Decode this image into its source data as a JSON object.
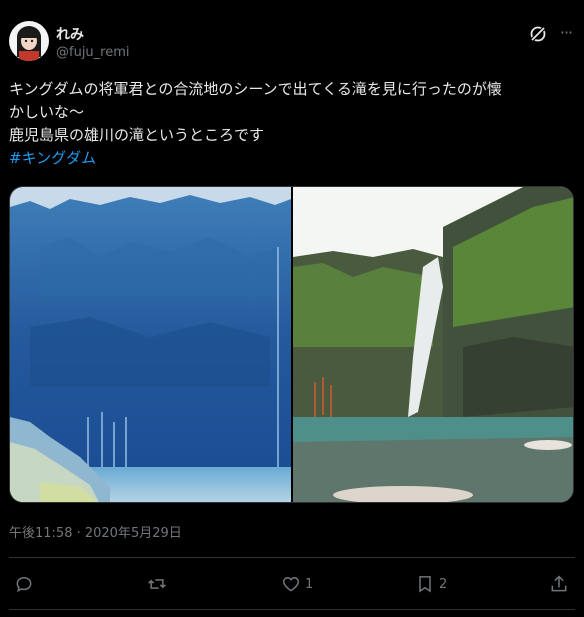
{
  "author": {
    "display_name": "れみ",
    "handle": "@fuju_remi"
  },
  "tweet": {
    "line1": "キングダムの将軍君との合流地のシーンで出てくる滝を見に行ったのが懐",
    "line2": "かしいな〜",
    "line3": "鹿児島県の雄川の滝というところです",
    "hashtag": "#キングダム"
  },
  "meta": {
    "timestamp": "午後11:58 · 2020年5月29日"
  },
  "actions": {
    "reply_icon": "reply-icon",
    "retweet_icon": "retweet-icon",
    "like_count": "1",
    "bookmark_count": "2",
    "share_icon": "share-icon"
  },
  "colors": {
    "accent": "#1d9bf0",
    "muted": "#71767b",
    "text": "#e7e9ea",
    "background": "#000000"
  }
}
